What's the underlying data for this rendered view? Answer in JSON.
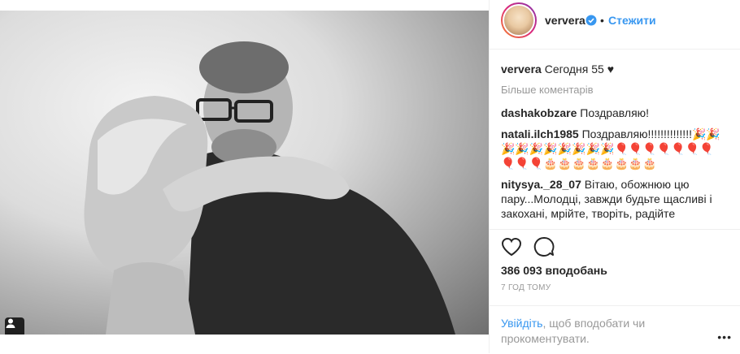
{
  "header": {
    "username": "ververa",
    "separator": "•",
    "follow_label": "Стежити"
  },
  "caption": {
    "username": "ververa",
    "text": "Сегодня 55 ♥"
  },
  "more_comments_label": "Більше коментарів",
  "comments": [
    {
      "username": "dashakobzare",
      "text": "Поздравляю!"
    },
    {
      "username": "natali.ilch1985",
      "text": "Поздравляю!!!!!!!!!!!!!!🎉🎉🎉🎉🎉🎉🎉🎉🎉🎉🎈🎈🎈🎈🎈🎈🎈🎈🎈🎈🎂🎂🎂🎂🎂🎂🎂🎂"
    },
    {
      "username": "nitysya._28_07",
      "text": "Вітаю, обожнюю цю пару...Молодці, завжди будьте щасливі і закохані, мрійте, творіть, радійте моментам..."
    }
  ],
  "likes_text": "386 093 вподобань",
  "time_text": "7 ГОД ТОМУ",
  "login": {
    "link_label": "Увійдіть",
    "rest_text": ", щоб вподобати чи прокоментувати."
  },
  "more_options_label": "•••",
  "icons": {
    "like": "heart-icon",
    "comment": "comment-icon",
    "verified": "verified-badge-icon",
    "tag": "user-tag-icon"
  },
  "colors": {
    "link": "#3897f0",
    "muted": "#999999",
    "text": "#262626",
    "divider": "#efefef"
  }
}
